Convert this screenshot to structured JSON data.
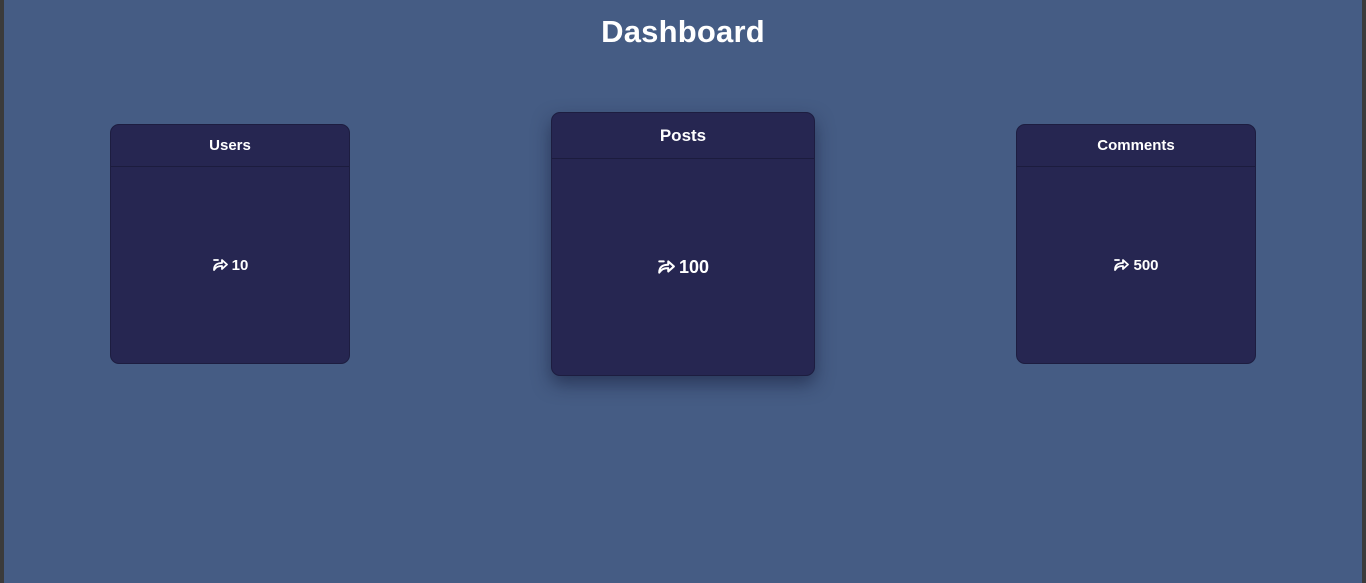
{
  "page": {
    "title": "Dashboard"
  },
  "cards": [
    {
      "label": "Users",
      "value": "10",
      "icon": "share-arrow-icon"
    },
    {
      "label": "Posts",
      "value": "100",
      "icon": "share-arrow-icon"
    },
    {
      "label": "Comments",
      "value": "500",
      "icon": "share-arrow-icon"
    }
  ],
  "colors": {
    "background": "#455c84",
    "card": "#262651",
    "text": "#ffffff"
  }
}
